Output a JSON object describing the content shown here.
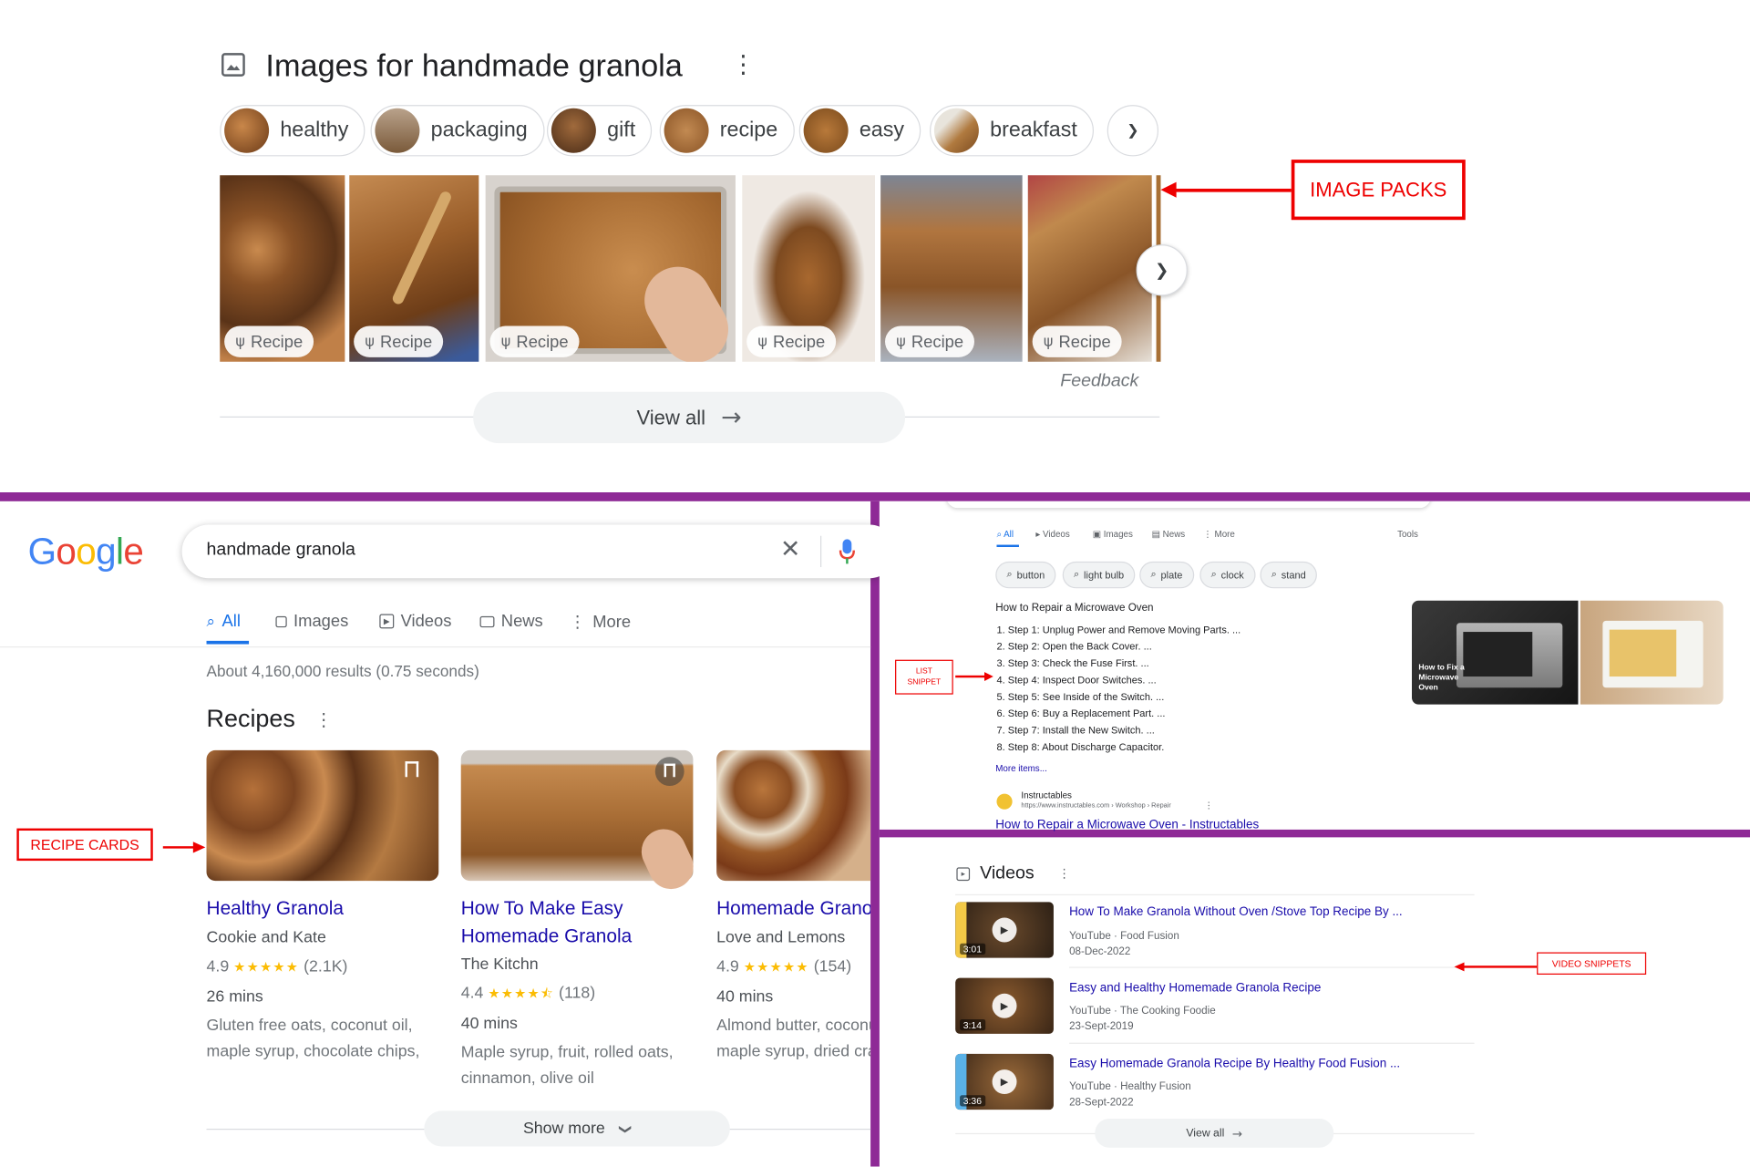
{
  "top": {
    "title": "Images for handmade granola",
    "chips": [
      "healthy",
      "packaging",
      "gift",
      "recipe",
      "easy",
      "breakfast"
    ],
    "badge": "Recipe",
    "feedback": "Feedback",
    "view_all": "View all"
  },
  "annotations": {
    "image_packs": "IMAGE PACKS",
    "recipe_cards": "RECIPE CARDS",
    "list_snippet_1": "LIST",
    "list_snippet_2": "SNIPPET",
    "video_snippets": "VIDEO SNIPPETS"
  },
  "serp": {
    "logo": [
      "G",
      "o",
      "o",
      "g",
      "l",
      "e"
    ],
    "query": "handmade granola",
    "tabs": [
      "All",
      "Images",
      "Videos",
      "News",
      "More"
    ],
    "result_stats": "About 4,160,000 results (0.75 seconds)",
    "section": "Recipes",
    "cards": [
      {
        "title": "Healthy Granola",
        "title2": "",
        "source": "Cookie and Kate",
        "rating": "4.9",
        "reviews": "(2.1K)",
        "time": "26 mins",
        "ing1": "Gluten free oats, coconut oil,",
        "ing2": "maple syrup, chocolate chips,",
        "stars": "★★★★★",
        "rating_value": 4.9
      },
      {
        "title": "How To Make Easy",
        "title2": "Homemade Granola",
        "source": "The Kitchn",
        "rating": "4.4",
        "reviews": "(118)",
        "time": "40 mins",
        "ing1": "Maple syrup, fruit, rolled oats,",
        "ing2": "cinnamon, olive oil",
        "stars": "★★★★⯪",
        "rating_value": 4.4
      },
      {
        "title": "Homemade Granol",
        "title2": "",
        "source": "Love and Lemons",
        "rating": "4.9",
        "reviews": "(154)",
        "time": "40 mins",
        "ing1": "Almond butter, coconu",
        "ing2": "maple syrup, dried cra",
        "stars": "★★★★★",
        "rating_value": 4.9
      }
    ],
    "show_more": "Show more"
  },
  "list": {
    "tabs": [
      "All",
      "Videos",
      "Images",
      "News",
      "More",
      "Tools"
    ],
    "chips": [
      "button",
      "light bulb",
      "plate",
      "clock",
      "stand"
    ],
    "heading": "How to Repair a Microwave Oven",
    "steps": [
      "1. Step 1: Unplug Power and Remove Moving Parts. ...",
      "2. Step 2: Open the Back Cover. ...",
      "3. Step 3: Check the Fuse First. ...",
      "4. Step 4: Inspect Door Switches. ...",
      "5. Step 5: See Inside of the Switch. ...",
      "6. Step 6: Buy a Replacement Part. ...",
      "7. Step 7: Install the New Switch. ...",
      "8. Step 8: About Discharge Capacitor."
    ],
    "more_items": "More items...",
    "site_name": "Instructables",
    "site_url": "https://www.instructables.com › Workshop › Repair",
    "result_link": "How to Repair a Microwave Oven - Instructables",
    "thumb_caption": [
      "How to Fix a",
      "Microwave",
      "Oven"
    ]
  },
  "videos": {
    "heading": "Videos",
    "items": [
      {
        "title": "How To Make Granola Without Oven /Stove Top Recipe By ...",
        "source": "YouTube · Food Fusion",
        "date": "08-Dec-2022",
        "duration": "3:01"
      },
      {
        "title": "Easy and Healthy Homemade Granola Recipe",
        "source": "YouTube · The Cooking Foodie",
        "date": "23-Sept-2019",
        "duration": "3:14"
      },
      {
        "title": "Easy Homemade Granola Recipe By Healthy Food Fusion ...",
        "source": "YouTube · Healthy Fusion",
        "date": "28-Sept-2022",
        "duration": "3:36"
      }
    ],
    "view_all": "View all"
  },
  "colors": {
    "divider": "#8e2a96",
    "link": "#1a0dab",
    "annotation_red": "#e00000",
    "star": "#fbbc04"
  }
}
